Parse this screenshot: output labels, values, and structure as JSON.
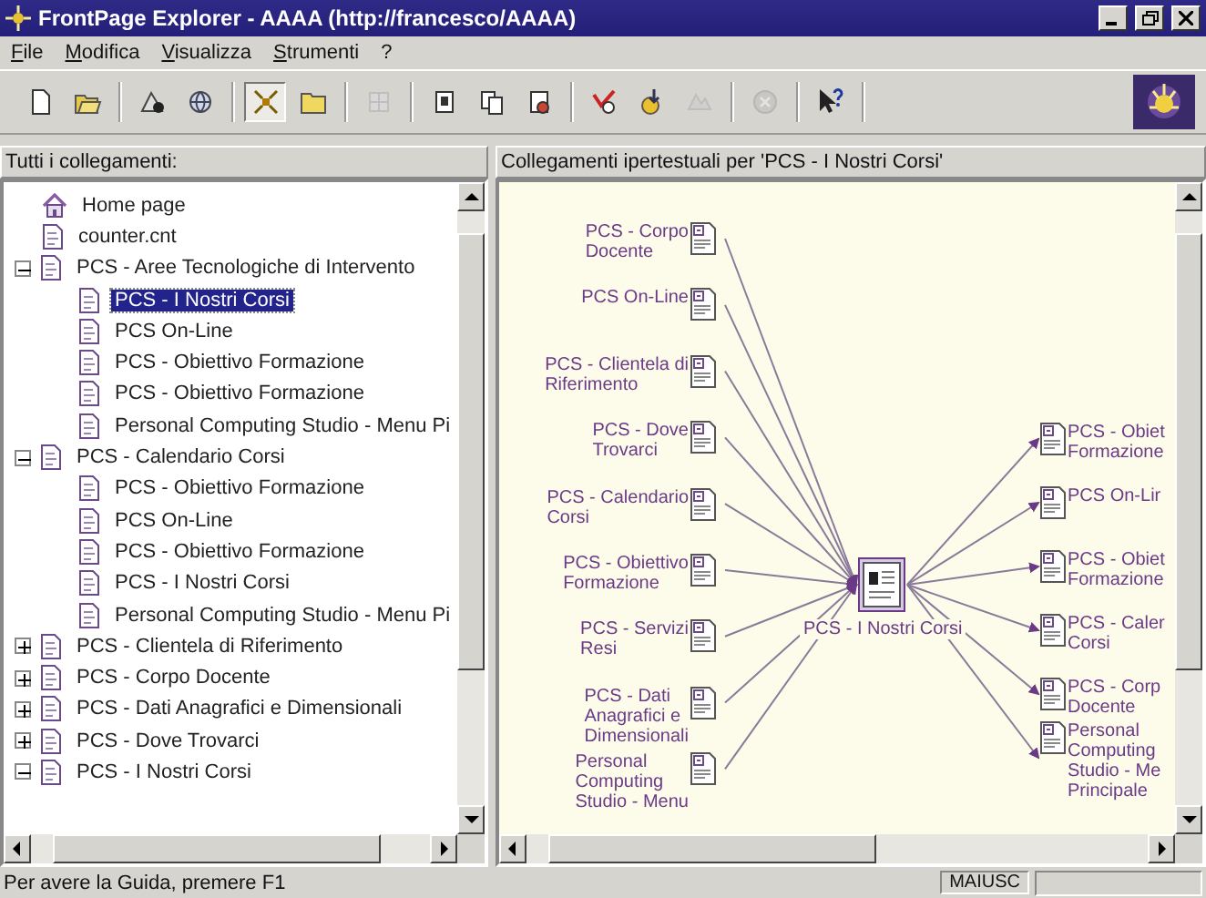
{
  "window": {
    "title": "FrontPage Explorer - AAAA (http://francesco/AAAA)"
  },
  "menu": [
    "File",
    "Modifica",
    "Visualizza",
    "Strumenti",
    "?"
  ],
  "toolbar": {
    "groups": [
      [
        {
          "kind": "new",
          "disabled": false,
          "pressed": false
        },
        {
          "kind": "open",
          "disabled": false,
          "pressed": false
        }
      ],
      [
        {
          "kind": "find",
          "disabled": false,
          "pressed": false
        },
        {
          "kind": "globe",
          "disabled": false,
          "pressed": false
        }
      ],
      [
        {
          "kind": "links-view",
          "disabled": false,
          "pressed": true
        },
        {
          "kind": "folder-view",
          "disabled": false,
          "pressed": false
        }
      ],
      [
        {
          "kind": "grid",
          "disabled": true,
          "pressed": false
        }
      ],
      [
        {
          "kind": "page",
          "disabled": false,
          "pressed": false
        },
        {
          "kind": "pages",
          "disabled": false,
          "pressed": false
        },
        {
          "kind": "page-edit",
          "disabled": false,
          "pressed": false
        }
      ],
      [
        {
          "kind": "verify",
          "disabled": false,
          "pressed": false
        },
        {
          "kind": "import",
          "disabled": false,
          "pressed": false
        },
        {
          "kind": "publish",
          "disabled": true,
          "pressed": false
        }
      ],
      [
        {
          "kind": "stop",
          "disabled": true,
          "pressed": false
        }
      ],
      [
        {
          "kind": "help",
          "disabled": false,
          "pressed": false
        }
      ]
    ]
  },
  "tree": {
    "title": "Tutti i collegamenti:",
    "items": [
      {
        "kind": "home",
        "label": "Home page",
        "selected": false
      },
      {
        "kind": "page",
        "label": "counter.cnt",
        "selected": false
      },
      {
        "kind": "page",
        "label": "PCS - Aree Tecnologiche di Intervento",
        "selected": false,
        "expanded": true,
        "children": [
          {
            "kind": "page",
            "label": "PCS - I Nostri Corsi",
            "selected": true
          },
          {
            "kind": "page",
            "label": "PCS On-Line",
            "selected": false
          },
          {
            "kind": "page",
            "label": "PCS - Obiettivo Formazione",
            "selected": false
          },
          {
            "kind": "page",
            "label": "PCS - Obiettivo Formazione",
            "selected": false
          },
          {
            "kind": "page",
            "label": "Personal Computing Studio - Menu Pi",
            "selected": false
          }
        ]
      },
      {
        "kind": "page",
        "label": "PCS - Calendario Corsi",
        "selected": false,
        "expanded": true,
        "children": [
          {
            "kind": "page",
            "label": "PCS - Obiettivo Formazione",
            "selected": false
          },
          {
            "kind": "page",
            "label": "PCS On-Line",
            "selected": false
          },
          {
            "kind": "page",
            "label": "PCS - Obiettivo Formazione",
            "selected": false
          },
          {
            "kind": "page",
            "label": "PCS - I Nostri Corsi",
            "selected": false
          },
          {
            "kind": "page",
            "label": "Personal Computing Studio - Menu Pi",
            "selected": false
          }
        ]
      },
      {
        "kind": "page",
        "label": "PCS - Clientela di Riferimento",
        "selected": false,
        "expanded": false
      },
      {
        "kind": "page",
        "label": "PCS - Corpo Docente",
        "selected": false,
        "expanded": false
      },
      {
        "kind": "page",
        "label": "PCS - Dati Anagrafici e Dimensionali",
        "selected": false,
        "expanded": false
      },
      {
        "kind": "page",
        "label": "PCS - Dove Trovarci",
        "selected": false,
        "expanded": false
      },
      {
        "kind": "page",
        "label": "PCS - I Nostri Corsi",
        "selected": false,
        "expanded": true
      }
    ]
  },
  "diagram": {
    "title": "Collegamenti ipertestuali per 'PCS - I Nostri Corsi'",
    "center": {
      "label": "PCS - I Nostri Corsi"
    },
    "incoming": [
      "PCS - Corpo\nDocente",
      "PCS On-Line",
      "PCS - Clientela di\nRiferimento",
      "PCS - Dove\nTrovarci",
      "PCS - Calendario\nCorsi",
      "PCS - Obiettivo\nFormazione",
      "PCS - Servizi\nResi",
      "PCS - Dati\nAnagrafici e\nDimensionali",
      "Personal\nComputing\nStudio - Menu"
    ],
    "outgoing": [
      "PCS - Obiet\nFormazione",
      "PCS On-Lir",
      "PCS - Obiet\nFormazione",
      "PCS - Caler\nCorsi",
      "PCS - Corp\nDocente",
      "Personal\nComputing\nStudio - Me\nPrincipale"
    ]
  },
  "status_bar": {
    "message": "Per avere la Guida, premere F1",
    "indicator": "MAIUSC"
  }
}
